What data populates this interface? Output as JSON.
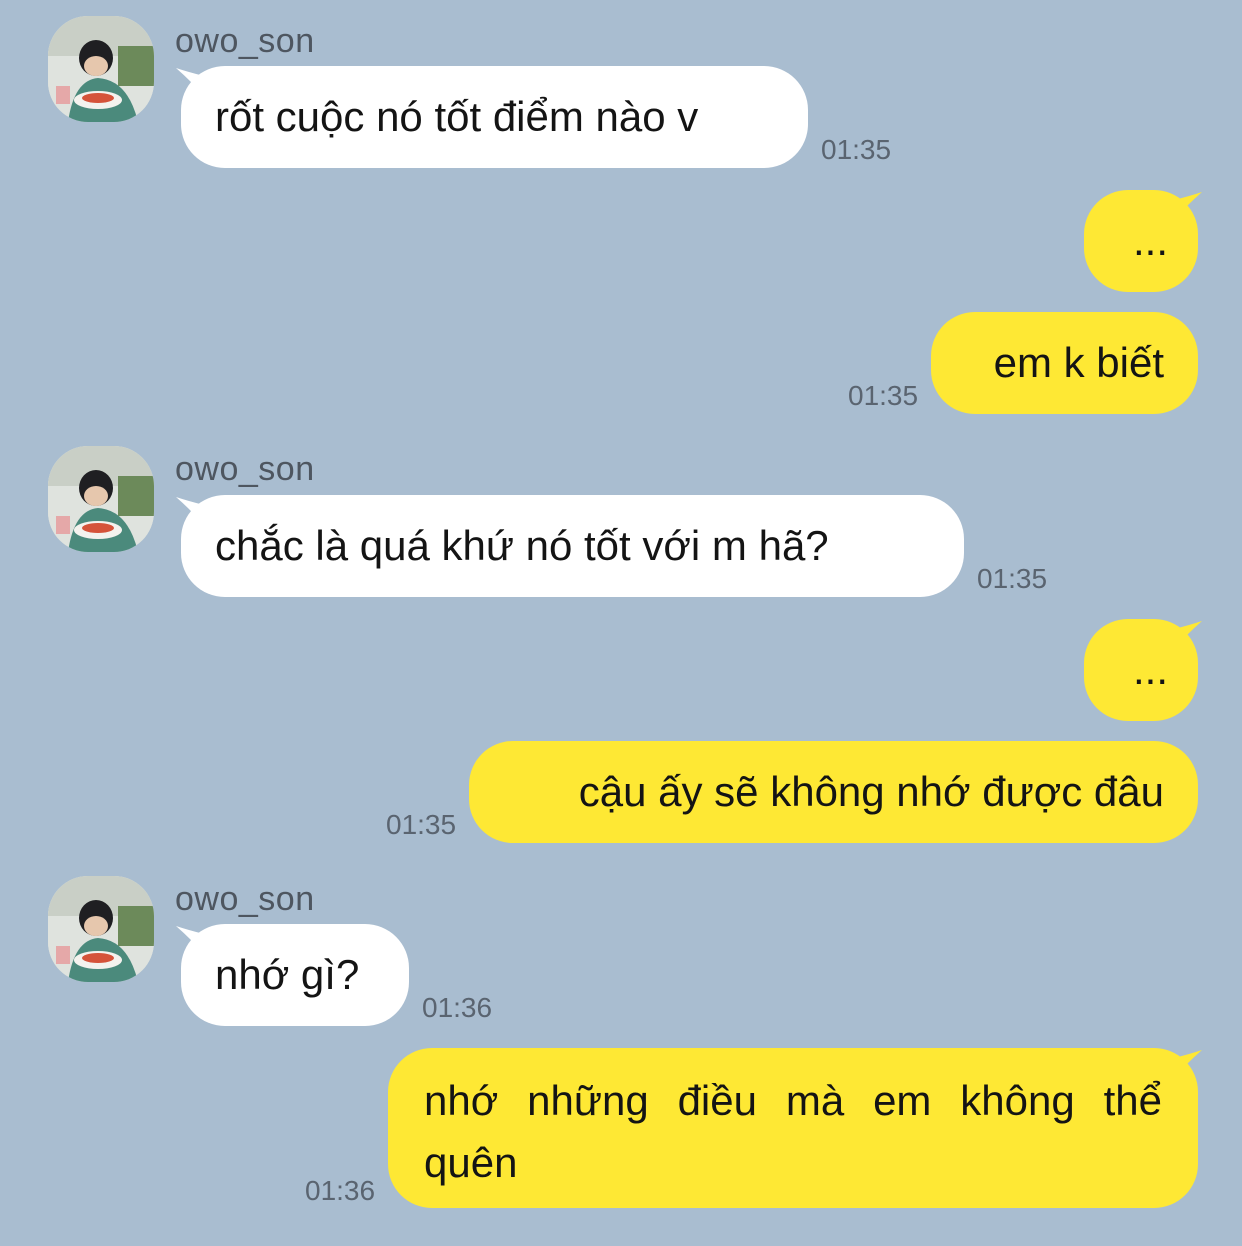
{
  "colors": {
    "background": "#a9bdd0",
    "incoming_bubble": "#ffffff",
    "outgoing_bubble": "#fee834",
    "timestamp": "#5a6470"
  },
  "messages": [
    {
      "direction": "incoming",
      "sender": "owo_son",
      "text": "rốt cuộc nó tốt điểm nào v",
      "time": "01:35"
    },
    {
      "direction": "outgoing",
      "text": "...",
      "time": ""
    },
    {
      "direction": "outgoing",
      "text": "em k biết",
      "time": "01:35"
    },
    {
      "direction": "incoming",
      "sender": "owo_son",
      "text": "chắc là quá khứ nó tốt với m hã?",
      "time": "01:35"
    },
    {
      "direction": "outgoing",
      "text": "...",
      "time": ""
    },
    {
      "direction": "outgoing",
      "text": "cậu ấy sẽ không nhớ được đâu",
      "time": "01:35"
    },
    {
      "direction": "incoming",
      "sender": "owo_son",
      "text": "nhớ gì?",
      "time": "01:36"
    },
    {
      "direction": "outgoing",
      "text": "nhớ những điều mà em không thể quên",
      "time": "01:36"
    }
  ],
  "avatar_icon": "profile-photo-avatar"
}
